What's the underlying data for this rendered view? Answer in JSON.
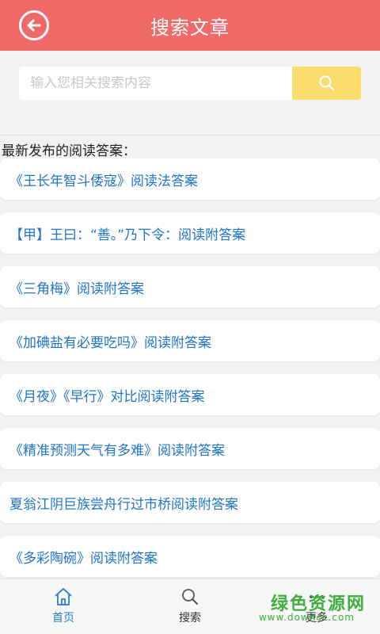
{
  "header": {
    "title": "搜索文章",
    "back_icon": "back-arrow-circle-icon"
  },
  "search": {
    "placeholder": "输入您相关搜索内容",
    "button_icon": "search-icon",
    "button_color": "#fadd6c"
  },
  "section": {
    "title": "最新发布的阅读答案："
  },
  "articles": [
    "《王长年智斗倭寇》阅读法答案",
    "【甲】王曰：“善。”乃下令：阅读附答案",
    "《三角梅》阅读附答案",
    "《加碘盐有必要吃吗》阅读附答案",
    "《月夜》《早行》对比阅读附答案",
    "《精准预测天气有多难》阅读附答案",
    "夏翁江阴巨族尝舟行过市桥阅读附答案",
    "《多彩陶碗》阅读附答案"
  ],
  "tabbar": {
    "items": [
      {
        "label": "首页",
        "icon": "home-icon",
        "active": true
      },
      {
        "label": "搜索",
        "icon": "search-icon",
        "active": false
      },
      {
        "label": "更多",
        "icon": "more-icon",
        "active": false
      }
    ]
  },
  "watermark": {
    "main": "绿色资源网",
    "sub": "www.downcc.com"
  },
  "colors": {
    "header": "#f06a6a",
    "link": "#1f74c8",
    "active_tab": "#2a7cd1"
  }
}
